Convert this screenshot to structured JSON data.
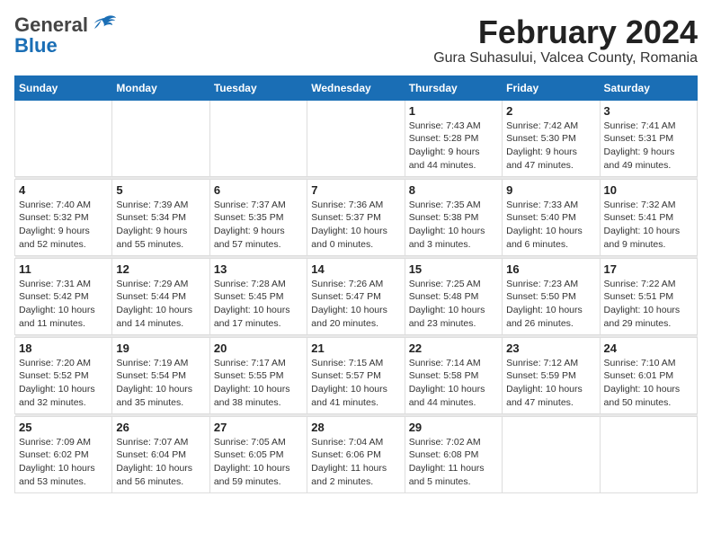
{
  "header": {
    "logo_general": "General",
    "logo_blue": "Blue",
    "title": "February 2024",
    "subtitle": "Gura Suhasului, Valcea County, Romania"
  },
  "weekdays": [
    "Sunday",
    "Monday",
    "Tuesday",
    "Wednesday",
    "Thursday",
    "Friday",
    "Saturday"
  ],
  "weeks": [
    [
      {
        "day": "",
        "info": ""
      },
      {
        "day": "",
        "info": ""
      },
      {
        "day": "",
        "info": ""
      },
      {
        "day": "",
        "info": ""
      },
      {
        "day": "1",
        "info": "Sunrise: 7:43 AM\nSunset: 5:28 PM\nDaylight: 9 hours\nand 44 minutes."
      },
      {
        "day": "2",
        "info": "Sunrise: 7:42 AM\nSunset: 5:30 PM\nDaylight: 9 hours\nand 47 minutes."
      },
      {
        "day": "3",
        "info": "Sunrise: 7:41 AM\nSunset: 5:31 PM\nDaylight: 9 hours\nand 49 minutes."
      }
    ],
    [
      {
        "day": "4",
        "info": "Sunrise: 7:40 AM\nSunset: 5:32 PM\nDaylight: 9 hours\nand 52 minutes."
      },
      {
        "day": "5",
        "info": "Sunrise: 7:39 AM\nSunset: 5:34 PM\nDaylight: 9 hours\nand 55 minutes."
      },
      {
        "day": "6",
        "info": "Sunrise: 7:37 AM\nSunset: 5:35 PM\nDaylight: 9 hours\nand 57 minutes."
      },
      {
        "day": "7",
        "info": "Sunrise: 7:36 AM\nSunset: 5:37 PM\nDaylight: 10 hours\nand 0 minutes."
      },
      {
        "day": "8",
        "info": "Sunrise: 7:35 AM\nSunset: 5:38 PM\nDaylight: 10 hours\nand 3 minutes."
      },
      {
        "day": "9",
        "info": "Sunrise: 7:33 AM\nSunset: 5:40 PM\nDaylight: 10 hours\nand 6 minutes."
      },
      {
        "day": "10",
        "info": "Sunrise: 7:32 AM\nSunset: 5:41 PM\nDaylight: 10 hours\nand 9 minutes."
      }
    ],
    [
      {
        "day": "11",
        "info": "Sunrise: 7:31 AM\nSunset: 5:42 PM\nDaylight: 10 hours\nand 11 minutes."
      },
      {
        "day": "12",
        "info": "Sunrise: 7:29 AM\nSunset: 5:44 PM\nDaylight: 10 hours\nand 14 minutes."
      },
      {
        "day": "13",
        "info": "Sunrise: 7:28 AM\nSunset: 5:45 PM\nDaylight: 10 hours\nand 17 minutes."
      },
      {
        "day": "14",
        "info": "Sunrise: 7:26 AM\nSunset: 5:47 PM\nDaylight: 10 hours\nand 20 minutes."
      },
      {
        "day": "15",
        "info": "Sunrise: 7:25 AM\nSunset: 5:48 PM\nDaylight: 10 hours\nand 23 minutes."
      },
      {
        "day": "16",
        "info": "Sunrise: 7:23 AM\nSunset: 5:50 PM\nDaylight: 10 hours\nand 26 minutes."
      },
      {
        "day": "17",
        "info": "Sunrise: 7:22 AM\nSunset: 5:51 PM\nDaylight: 10 hours\nand 29 minutes."
      }
    ],
    [
      {
        "day": "18",
        "info": "Sunrise: 7:20 AM\nSunset: 5:52 PM\nDaylight: 10 hours\nand 32 minutes."
      },
      {
        "day": "19",
        "info": "Sunrise: 7:19 AM\nSunset: 5:54 PM\nDaylight: 10 hours\nand 35 minutes."
      },
      {
        "day": "20",
        "info": "Sunrise: 7:17 AM\nSunset: 5:55 PM\nDaylight: 10 hours\nand 38 minutes."
      },
      {
        "day": "21",
        "info": "Sunrise: 7:15 AM\nSunset: 5:57 PM\nDaylight: 10 hours\nand 41 minutes."
      },
      {
        "day": "22",
        "info": "Sunrise: 7:14 AM\nSunset: 5:58 PM\nDaylight: 10 hours\nand 44 minutes."
      },
      {
        "day": "23",
        "info": "Sunrise: 7:12 AM\nSunset: 5:59 PM\nDaylight: 10 hours\nand 47 minutes."
      },
      {
        "day": "24",
        "info": "Sunrise: 7:10 AM\nSunset: 6:01 PM\nDaylight: 10 hours\nand 50 minutes."
      }
    ],
    [
      {
        "day": "25",
        "info": "Sunrise: 7:09 AM\nSunset: 6:02 PM\nDaylight: 10 hours\nand 53 minutes."
      },
      {
        "day": "26",
        "info": "Sunrise: 7:07 AM\nSunset: 6:04 PM\nDaylight: 10 hours\nand 56 minutes."
      },
      {
        "day": "27",
        "info": "Sunrise: 7:05 AM\nSunset: 6:05 PM\nDaylight: 10 hours\nand 59 minutes."
      },
      {
        "day": "28",
        "info": "Sunrise: 7:04 AM\nSunset: 6:06 PM\nDaylight: 11 hours\nand 2 minutes."
      },
      {
        "day": "29",
        "info": "Sunrise: 7:02 AM\nSunset: 6:08 PM\nDaylight: 11 hours\nand 5 minutes."
      },
      {
        "day": "",
        "info": ""
      },
      {
        "day": "",
        "info": ""
      }
    ]
  ]
}
